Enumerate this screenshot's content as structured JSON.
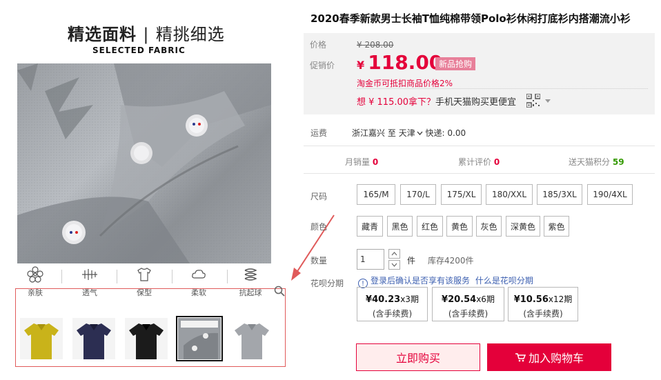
{
  "gallery": {
    "banner_main_bold": "精选面料",
    "banner_main_light": "精挑细选",
    "banner_sub": "SELECTED FABRIC",
    "features": [
      {
        "label": "亲肤",
        "icon": "flower-icon"
      },
      {
        "label": "透气",
        "icon": "grass-icon"
      },
      {
        "label": "保型",
        "icon": "shirt-icon"
      },
      {
        "label": "柔软",
        "icon": "cloud-icon"
      },
      {
        "label": "抗起球",
        "icon": "spring-icon"
      }
    ],
    "thumbnails": [
      {
        "color": "#c9b31a",
        "selected": false
      },
      {
        "color": "#2c2e52",
        "selected": false
      },
      {
        "color": "#1b1b1b",
        "selected": false
      },
      {
        "color": "#8e9298",
        "selected": true
      },
      {
        "color": "#a3a6ab",
        "selected": false
      }
    ]
  },
  "product": {
    "title": "2020春季新款男士长袖T恤纯棉带领Polo衫休闲打底衫内搭潮流小衫"
  },
  "price": {
    "label": "价格",
    "original": "¥ 208.00",
    "promo_label": "促销价",
    "currency": "¥",
    "current": "118.00",
    "badge": "新品抢购",
    "coin_note": "淘金币可抵扣商品价格2%",
    "tmall_pre": "想 ¥ 115.00拿下？",
    "tmall_post": "手机天猫购买更便宜"
  },
  "shipping": {
    "label": "运费",
    "from": "浙江嘉兴",
    "to_word": "至",
    "to": "天津",
    "express": "快递: 0.00"
  },
  "stats": {
    "monthly_label": "月销量",
    "monthly_value": "0",
    "reviews_label": "累计评价",
    "reviews_value": "0",
    "points_label": "送天猫积分",
    "points_value": "59"
  },
  "size": {
    "label": "尺码",
    "options": [
      "165/M",
      "170/L",
      "175/XL",
      "180/XXL",
      "185/3XL",
      "190/4XL"
    ]
  },
  "color": {
    "label": "颜色",
    "options": [
      "藏青",
      "黑色",
      "红色",
      "黄色",
      "灰色",
      "深黄色",
      "紫色"
    ]
  },
  "quantity": {
    "label": "数量",
    "value": "1",
    "unit": "件",
    "stock": "库存4200件"
  },
  "huabei": {
    "label": "花呗分期",
    "info_icon": "info-icon",
    "notice": "登录后确认是否享有该服务",
    "link": "什么是花呗分期",
    "plans": [
      {
        "amount": "¥40.23",
        "periods": "x3期",
        "fee": "(含手续费)"
      },
      {
        "amount": "¥20.54",
        "periods": "x6期",
        "fee": "(含手续费)"
      },
      {
        "amount": "¥10.56",
        "periods": "x12期",
        "fee": "(含手续费)"
      }
    ]
  },
  "actions": {
    "buy_now": "立即购买",
    "add_cart": "加入购物车"
  },
  "colors": {
    "accent_red": "#e4003a",
    "price_bg": "#f2f2f2",
    "badge_pink": "#e8809a",
    "link_blue": "#3c5fb0"
  }
}
